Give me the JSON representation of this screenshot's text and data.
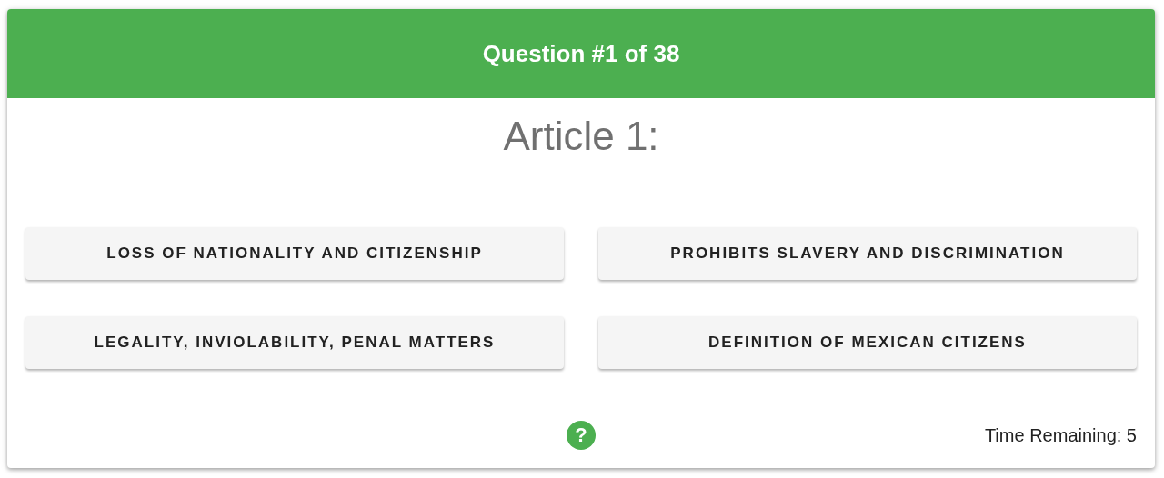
{
  "header": {
    "title": "Question #1 of 38"
  },
  "question": {
    "text": "Article 1:"
  },
  "answers": [
    {
      "label": "LOSS OF NATIONALITY AND CITIZENSHIP"
    },
    {
      "label": "PROHIBITS SLAVERY AND DISCRIMINATION"
    },
    {
      "label": "LEGALITY, INVIOLABILITY, PENAL MATTERS"
    },
    {
      "label": "DEFINITION OF MEXICAN CITIZENS"
    }
  ],
  "footer": {
    "help": "?",
    "timer": "Time Remaining: 5"
  }
}
